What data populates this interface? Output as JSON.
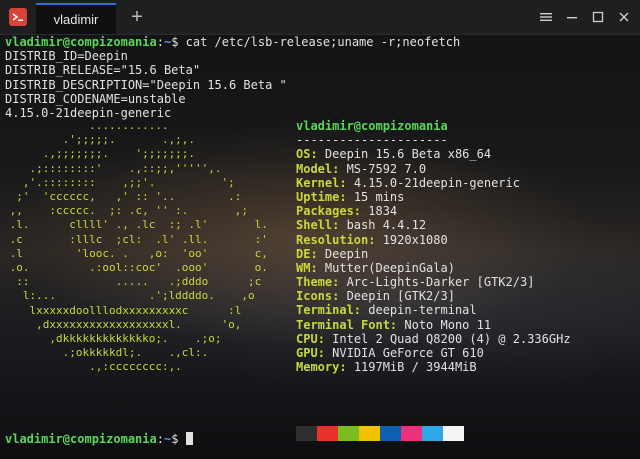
{
  "window": {
    "tab_label": "vladimir",
    "new_tab_symbol": "+",
    "app_icon": "terminal-app-icon",
    "controls": [
      "menu-icon",
      "minimize-icon",
      "maximize-icon",
      "close-icon"
    ]
  },
  "prompt": {
    "user_host": "vladimir@compizomania",
    "separator": ":",
    "path": "~",
    "symbol": "$",
    "command": "cat /etc/lsb-release;uname -r;neofetch"
  },
  "output_lines": [
    "DISTRIB_ID=Deepin",
    "DISTRIB_RELEASE=\"15.6 Beta\"",
    "DISTRIB_DESCRIPTION=\"Deepin 15.6 Beta \"",
    "DISTRIB_CODENAME=unstable",
    "4.15.0-21deepin-generic"
  ],
  "logo_lines": [
    "             ............",
    "         .';;;;;.       .,;,.",
    "      .,;;;;;;;.    ';;;;;;;.",
    "    .;::::::::'    .,::;;,''''',.",
    "   ,'.::::::::    ,;;'.          ';",
    "  ;'  'cccccc,   ,' :: '..        .:",
    " ,,    :ccccc.  ;: .c, '' :.       ,;",
    " .l.      cllll' ., .lc  :; .l'       l.",
    " .c       :lllc  ;cl:  .l' .ll.       :'",
    " .l        'looc. .   ,o:  'oo'       c,",
    " .o.         .:ool::coc'  .ooo'       o.",
    "  ::             .....   .;dddo      ;c",
    "   l:...              .';lddddo.    ,o",
    "    lxxxxxdoolllodxxxxxxxxxc      :l",
    "     ,dxxxxxxxxxxxxxxxxxxl.      'o,",
    "       ,dkkkkkkkkkkkkko;.    .;o;",
    "         .;okkkkkdl;.    .,cl:.",
    "             .,:cccccccc:,."
  ],
  "neofetch": {
    "title": "vladimir@compizomania",
    "divider": "---------------------",
    "fields": [
      {
        "key": "OS",
        "value": "Deepin 15.6 Beta x86_64"
      },
      {
        "key": "Model",
        "value": "MS-7592 7.0"
      },
      {
        "key": "Kernel",
        "value": "4.15.0-21deepin-generic"
      },
      {
        "key": "Uptime",
        "value": "15 mins"
      },
      {
        "key": "Packages",
        "value": "1834"
      },
      {
        "key": "Shell",
        "value": "bash 4.4.12"
      },
      {
        "key": "Resolution",
        "value": "1920x1080"
      },
      {
        "key": "DE",
        "value": "Deepin"
      },
      {
        "key": "WM",
        "value": "Mutter(DeepinGala)"
      },
      {
        "key": "Theme",
        "value": "Arc-Lights-Darker [GTK2/3]"
      },
      {
        "key": "Icons",
        "value": "Deepin [GTK2/3]"
      },
      {
        "key": "Terminal",
        "value": "deepin-terminal"
      },
      {
        "key": "Terminal Font",
        "value": "Noto Mono 11"
      },
      {
        "key": "CPU",
        "value": "Intel 2 Quad Q8200 (4) @ 2.336GHz"
      },
      {
        "key": "GPU",
        "value": "NVIDIA GeForce GT 610"
      },
      {
        "key": "Memory",
        "value": "1197MiB / 3944MiB"
      }
    ],
    "palette": [
      "#2f2f2f",
      "#e8312a",
      "#7bbd1e",
      "#f2c200",
      "#0f5fb2",
      "#ee2f7c",
      "#2ea7e8",
      "#f4f4f4"
    ]
  },
  "colors": {
    "prompt_user": "#5dd45b",
    "prompt_path": "#6f8cf0",
    "logo": "#c9d83a",
    "tab_accent": "#2c6fd1"
  }
}
